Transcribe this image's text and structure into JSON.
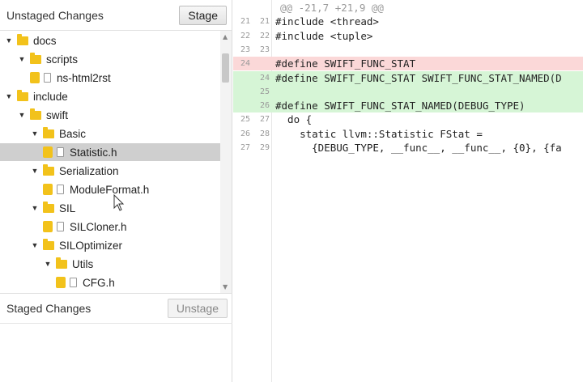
{
  "unstaged": {
    "title": "Unstaged Changes",
    "stage_label": "Stage",
    "tree": [
      {
        "label": "docs",
        "kind": "folder",
        "depth": 0,
        "expanded": true
      },
      {
        "label": "scripts",
        "kind": "folder",
        "depth": 1,
        "expanded": true
      },
      {
        "label": "ns-html2rst",
        "kind": "file",
        "depth": 2
      },
      {
        "label": "include",
        "kind": "folder",
        "depth": 0,
        "expanded": true
      },
      {
        "label": "swift",
        "kind": "folder",
        "depth": 1,
        "expanded": true
      },
      {
        "label": "Basic",
        "kind": "folder",
        "depth": 2,
        "expanded": true
      },
      {
        "label": "Statistic.h",
        "kind": "file",
        "depth": 3,
        "selected": true
      },
      {
        "label": "Serialization",
        "kind": "folder",
        "depth": 2,
        "expanded": true
      },
      {
        "label": "ModuleFormat.h",
        "kind": "file",
        "depth": 3
      },
      {
        "label": "SIL",
        "kind": "folder",
        "depth": 2,
        "expanded": true
      },
      {
        "label": "SILCloner.h",
        "kind": "file",
        "depth": 3
      },
      {
        "label": "SILOptimizer",
        "kind": "folder",
        "depth": 2,
        "expanded": true
      },
      {
        "label": "Utils",
        "kind": "folder",
        "depth": 3,
        "expanded": true
      },
      {
        "label": "CFG.h",
        "kind": "file",
        "depth": 4
      }
    ]
  },
  "staged": {
    "title": "Staged Changes",
    "unstage_label": "Unstage"
  },
  "diff": {
    "hunk_header": "@@ -21,7 +21,9 @@",
    "lines": [
      {
        "old": "21",
        "new": "21",
        "type": "context",
        "text": "#include <thread>"
      },
      {
        "old": "22",
        "new": "22",
        "type": "context",
        "text": "#include <tuple>"
      },
      {
        "old": "23",
        "new": "23",
        "type": "context",
        "text": ""
      },
      {
        "old": "24",
        "new": "",
        "type": "removed",
        "text": "#define SWIFT_FUNC_STAT"
      },
      {
        "old": "",
        "new": "24",
        "type": "added",
        "text": "#define SWIFT_FUNC_STAT SWIFT_FUNC_STAT_NAMED(D"
      },
      {
        "old": "",
        "new": "25",
        "type": "added",
        "text": ""
      },
      {
        "old": "",
        "new": "26",
        "type": "added",
        "text": "#define SWIFT_FUNC_STAT_NAMED(DEBUG_TYPE)"
      },
      {
        "old": "25",
        "new": "27",
        "type": "context",
        "text": "  do {"
      },
      {
        "old": "26",
        "new": "28",
        "type": "context",
        "text": "    static llvm::Statistic FStat ="
      },
      {
        "old": "27",
        "new": "29",
        "type": "context",
        "text": "      {DEBUG_TYPE, __func__, __func__, {0}, {fa"
      }
    ]
  },
  "colors": {
    "folder": "#f2c21b",
    "selected_row": "#cfcfcf",
    "removed_bg": "#fbd8d8",
    "added_bg": "#d6f5d6"
  }
}
